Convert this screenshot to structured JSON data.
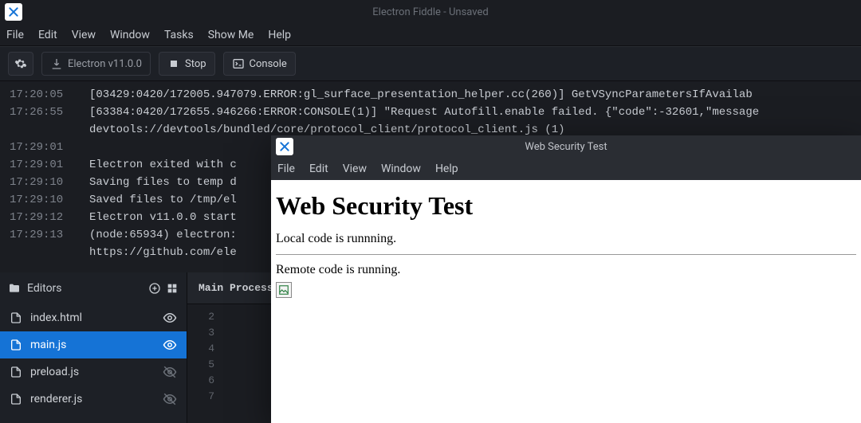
{
  "colors": {
    "accent": "#1573d6",
    "bg": "#1b1d22",
    "panel": "#1d2026",
    "text": "#c8ccd2"
  },
  "main_window": {
    "title": "Electron Fiddle - Unsaved",
    "menubar": [
      "File",
      "Edit",
      "View",
      "Window",
      "Tasks",
      "Show Me",
      "Help"
    ],
    "toolbar": {
      "settings_icon": "gear-icon",
      "version_label": "Electron v11.0.0",
      "stop_label": "Stop",
      "console_label": "Console"
    },
    "console": [
      {
        "ts": "17:20:05",
        "msg": "[03429:0420/172005.947079.ERROR:gl_surface_presentation_helper.cc(260)] GetVSyncParametersIfAvailab"
      },
      {
        "ts": "17:26:55",
        "msg": "[63384:0420/172655.946266:ERROR:CONSOLE(1)] \"Request Autofill.enable failed. {\"code\":-32601,\"message"
      },
      {
        "ts": "",
        "msg": "devtools://devtools/bundled/core/protocol_client/protocol_client.js (1)"
      },
      {
        "ts": "17:29:01",
        "msg": ""
      },
      {
        "ts": "17:29:01",
        "msg": "Electron exited with c"
      },
      {
        "ts": "17:29:10",
        "msg": "Saving files to temp d"
      },
      {
        "ts": "17:29:10",
        "msg": "Saved files to /tmp/el"
      },
      {
        "ts": "17:29:12",
        "msg": "Electron v11.0.0 start"
      },
      {
        "ts": "17:29:13",
        "msg": "(node:65934) electron:"
      },
      {
        "ts": "",
        "msg": "https://github.com/ele",
        "link": true
      }
    ],
    "sidebar": {
      "title": "Editors",
      "add_icon": "plus-circle-icon",
      "grid_icon": "grid-icon",
      "files": [
        {
          "name": "index.html",
          "visible": true,
          "active": false
        },
        {
          "name": "main.js",
          "visible": true,
          "active": true
        },
        {
          "name": "preload.js",
          "visible": false,
          "active": false
        },
        {
          "name": "renderer.js",
          "visible": false,
          "active": false
        }
      ]
    },
    "editor": {
      "tab_label": "Main Process",
      "line_numbers": [
        "2",
        "3",
        "4",
        "5",
        "6",
        "7"
      ]
    }
  },
  "child_window": {
    "title": "Web Security Test",
    "menubar": [
      "File",
      "Edit",
      "View",
      "Window",
      "Help"
    ],
    "heading": "Web Security Test",
    "line1": "Local code is runnning.",
    "line2": "Remote code is running.",
    "broken_image_icon": "broken-image-icon"
  }
}
